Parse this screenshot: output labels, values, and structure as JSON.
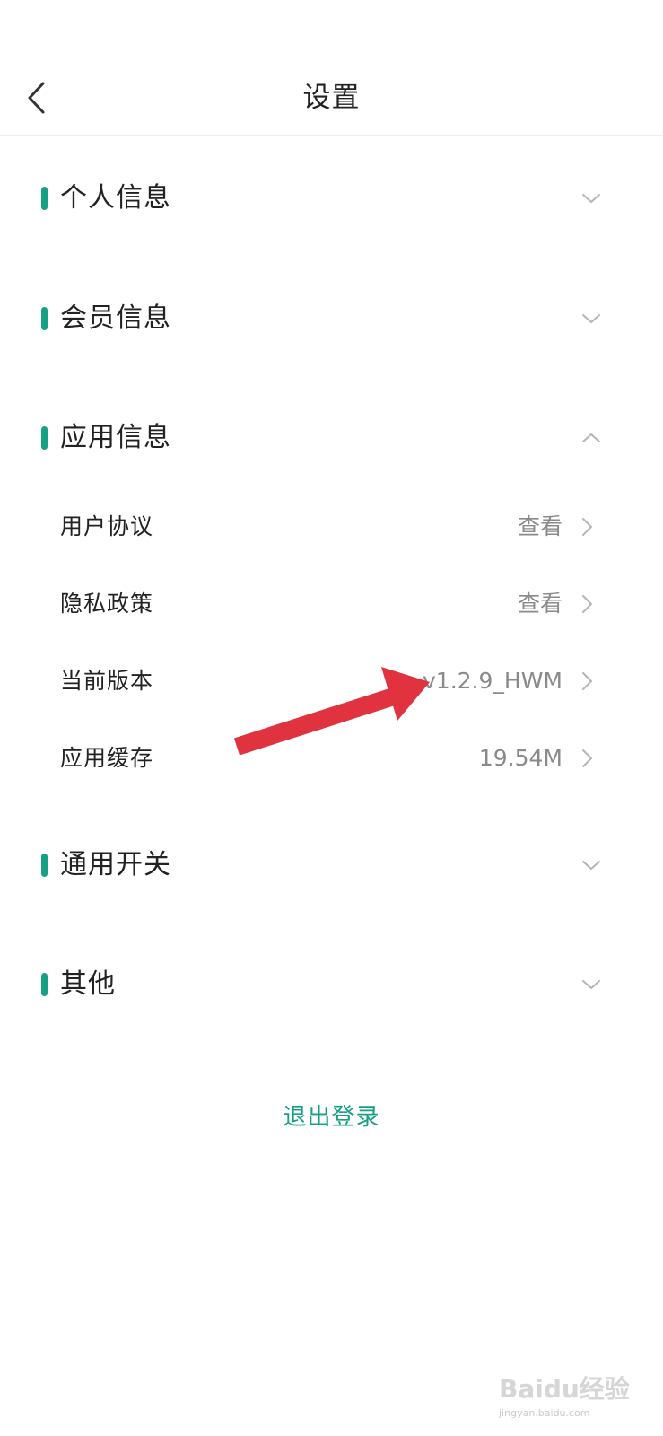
{
  "header": {
    "title": "设置",
    "back_icon": "chevron-left-icon"
  },
  "sections": [
    {
      "label": "个人信息",
      "expanded": false
    },
    {
      "label": "会员信息",
      "expanded": false
    },
    {
      "label": "应用信息",
      "expanded": true
    },
    {
      "label": "通用开关",
      "expanded": false
    },
    {
      "label": "其他",
      "expanded": false
    }
  ],
  "app_info_items": [
    {
      "label": "用户协议",
      "value": "查看"
    },
    {
      "label": "隐私政策",
      "value": "查看"
    },
    {
      "label": "当前版本",
      "value": "v1.2.9_HWM"
    },
    {
      "label": "应用缓存",
      "value": "19.54M"
    }
  ],
  "logout_label": "退出登录",
  "colors": {
    "accent": "#17a085",
    "annotation_arrow": "#e0323f",
    "secondary_text": "#8a8a8a"
  },
  "watermark": {
    "text": "Baidu经验",
    "url": "jingyan.baidu.com"
  }
}
